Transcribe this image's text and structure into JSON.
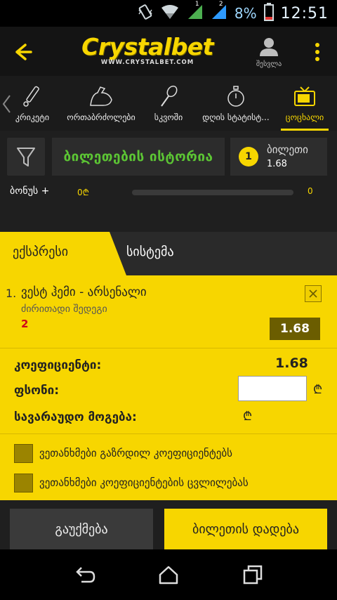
{
  "status_bar": {
    "battery_percent": "8%",
    "time": "12:51",
    "signal_1_label": "1",
    "signal_2_label": "2"
  },
  "app_bar": {
    "brand": "Crystalbet",
    "brand_site": "WWW.CRYSTALBET.COM",
    "account_label": "შესვლა"
  },
  "sports": [
    {
      "label": "კრიკეტი",
      "icon": "cricket-bat-icon"
    },
    {
      "label": "ორთაბრძოლები",
      "icon": "muscle-arm-icon"
    },
    {
      "label": "სკვოში",
      "icon": "squash-racket-icon"
    },
    {
      "label": "დღის სტატისტ...",
      "icon": "stopwatch-icon"
    },
    {
      "label": "ცოცხალი",
      "icon": "tv-icon",
      "active": true
    }
  ],
  "ticket": {
    "history_label": "ბილეთების ისტორია",
    "count": "1",
    "ticket_label": "ბილეთი",
    "ticket_odd": "1.68"
  },
  "bonus": {
    "label": "ბონუს +",
    "value": "0₾",
    "max": "0",
    "progress": 0
  },
  "slip": {
    "tab_express": "ექსპრესი",
    "tab_system": "სისტემა",
    "event": {
      "index": "1.",
      "name": "ვესტ ჰემი - არსენალი",
      "market": "ძირითადი შედეგი",
      "outcome": "2",
      "odd": "1.68"
    },
    "coef_label": "კოეფიციენტი:",
    "coef_value": "1.68",
    "stake_label": "ფსონი:",
    "stake_value": "",
    "currency": "₾",
    "win_label": "სავარაუდო მოგება:",
    "check_increase": "ვეთანხმები გაზრდილ კოეფიციენტებს",
    "check_change": "ვეთანხმები კოეფიციენტების ცვლილებას"
  },
  "actions": {
    "cancel": "გაუქმება",
    "place": "ბილეთის დადება"
  },
  "colors": {
    "accent": "#f7d600",
    "green": "#5cc534",
    "red": "#d0021b"
  }
}
